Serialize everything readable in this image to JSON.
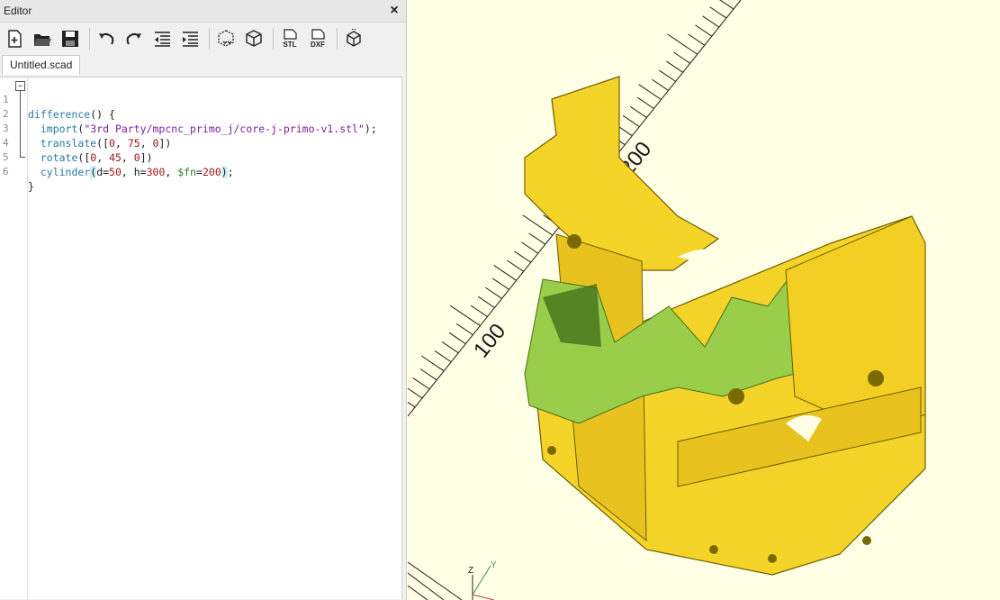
{
  "editor": {
    "title": "Editor",
    "close_glyph": "×",
    "toolbar": [
      {
        "icon": "new-file-icon"
      },
      {
        "icon": "open-file-icon"
      },
      {
        "icon": "save-file-icon"
      },
      {
        "icon": "undo-icon"
      },
      {
        "icon": "redo-icon"
      },
      {
        "icon": "unindent-icon"
      },
      {
        "icon": "indent-icon"
      },
      {
        "icon": "preview-icon"
      },
      {
        "icon": "render-icon"
      },
      {
        "icon": "export-stl-icon",
        "label": "STL"
      },
      {
        "icon": "export-dxf-icon",
        "label": "DXF"
      },
      {
        "icon": "send-to-print-icon"
      }
    ],
    "tab_name": "Untitled.scad",
    "code_lines": [
      {
        "n": "1",
        "text": "difference() {"
      },
      {
        "n": "2",
        "text": "  import(\"3rd Party/mpcnc_primo_j/core-j-primo-v1.stl\");"
      },
      {
        "n": "3",
        "text": "  translate([0, 75, 0])"
      },
      {
        "n": "4",
        "text": "  rotate([0, 45, 0])"
      },
      {
        "n": "5",
        "text": "  cylinder(d=50, h=300, $fn=200);"
      },
      {
        "n": "6",
        "text": "}"
      }
    ]
  },
  "viewport": {
    "axis_labels": [
      "100",
      "200"
    ],
    "axes_gizmo": {
      "z": "Z",
      "y": "Y"
    },
    "colors": {
      "background": "#ffffe5",
      "model": "#f5d42a",
      "cut_face": "#9acd4a",
      "ruler": "#1a1a1a"
    }
  }
}
